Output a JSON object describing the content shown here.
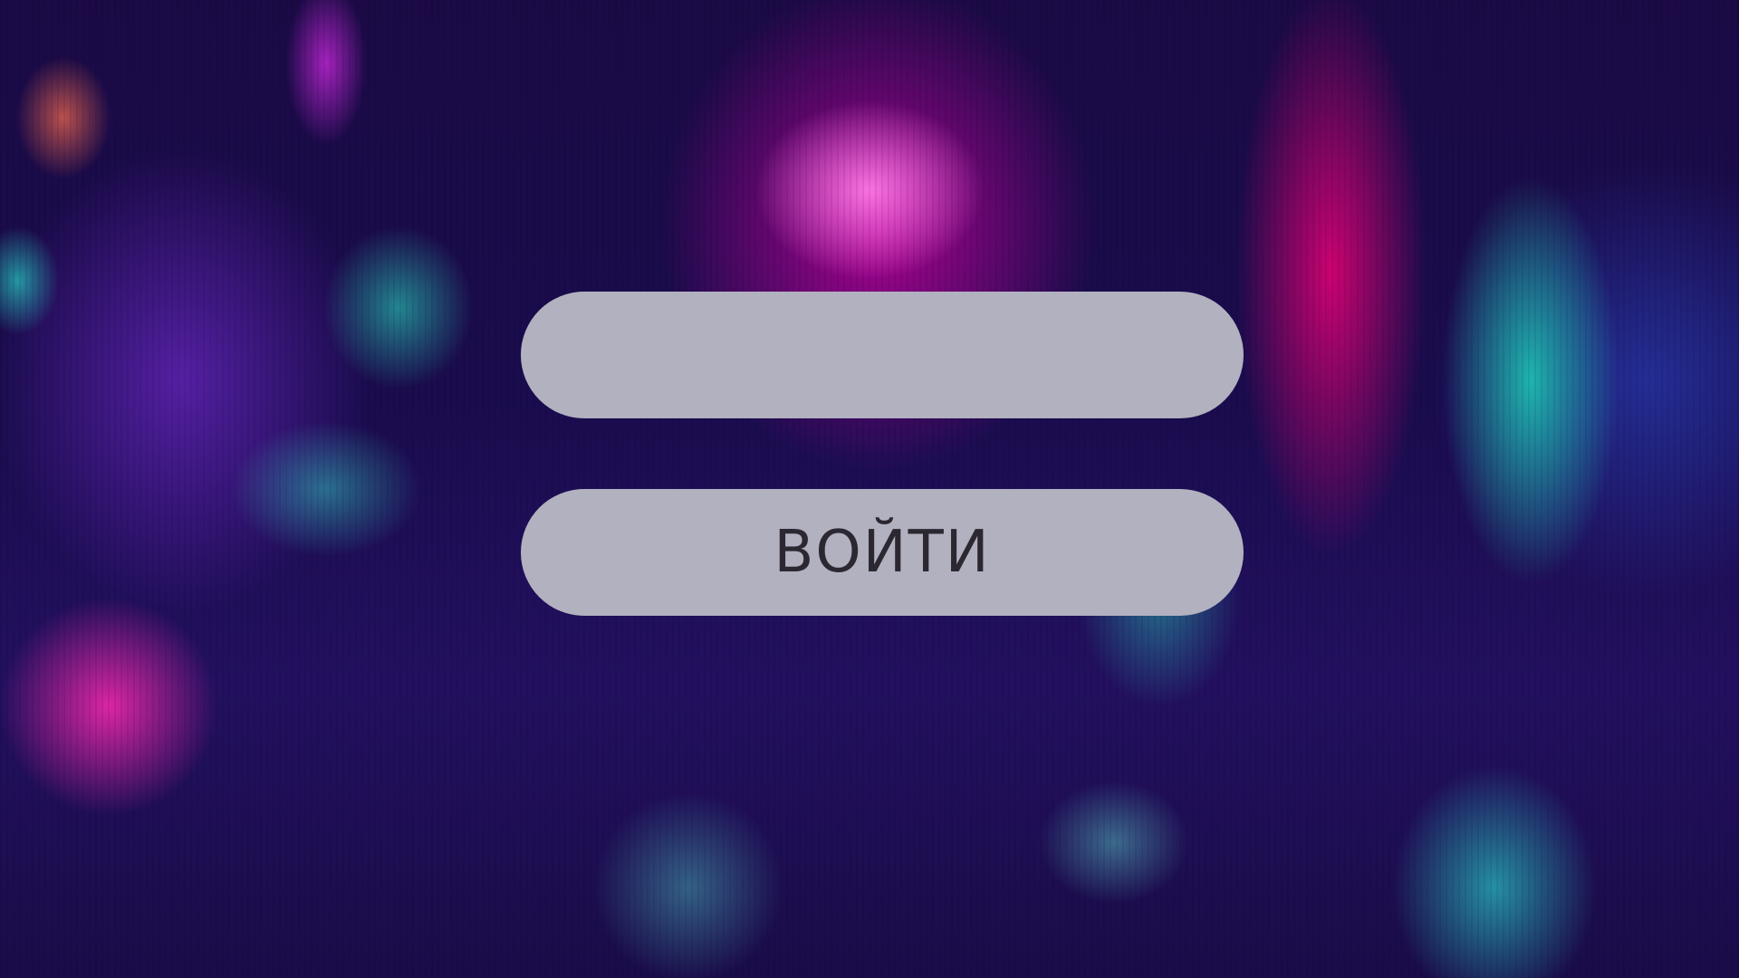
{
  "login_form": {
    "input_value": "",
    "input_placeholder": "",
    "submit_label": "ВОЙТИ"
  },
  "colors": {
    "pill_background": "#b2b1bf",
    "button_text": "#2b2832",
    "backdrop_base": "#1a0c4e",
    "neon_magenta": "#d000a8",
    "neon_teal": "#1ed8be"
  }
}
